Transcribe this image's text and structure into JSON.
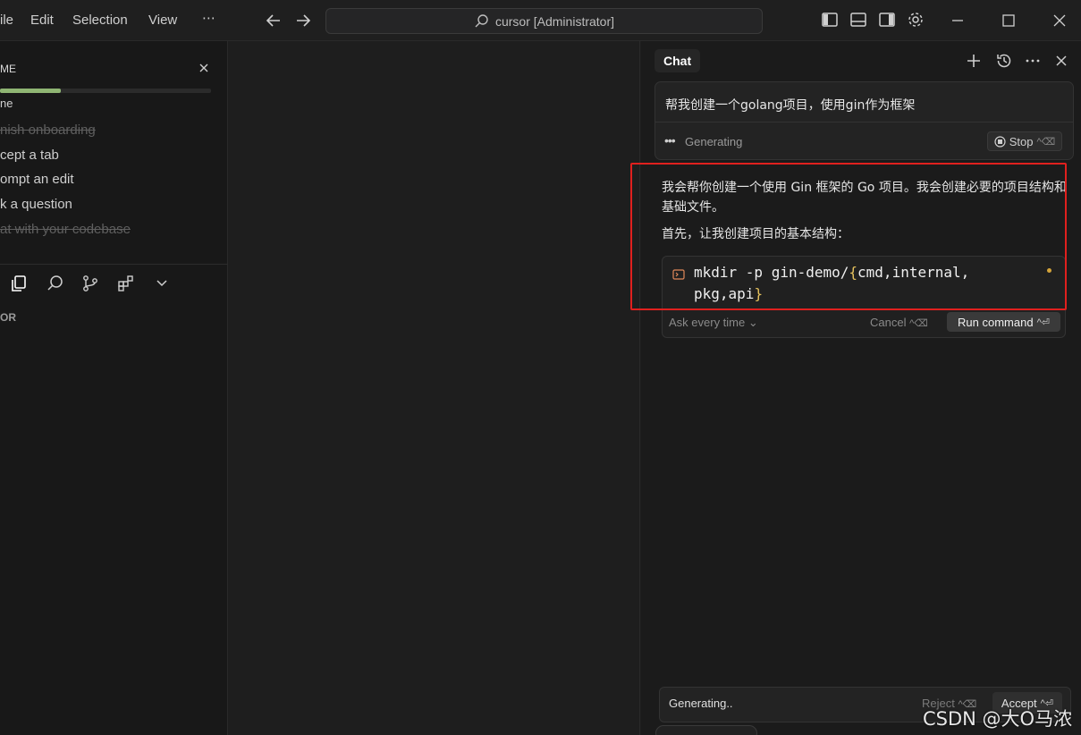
{
  "titlebar": {
    "menus": [
      "ile",
      "Edit",
      "Selection",
      "View",
      "⋯"
    ],
    "search_text": "cursor [Administrator]"
  },
  "sidebar": {
    "onboarding_title": "ME",
    "progress_fraction": 0.29,
    "onboarding_sub": "ne",
    "items": [
      {
        "label": "nish onboarding",
        "done": true
      },
      {
        "label": "cept a tab",
        "done": false
      },
      {
        "label": "ompt an edit",
        "done": false
      },
      {
        "label": "k a question",
        "done": false
      },
      {
        "label": "at with your codebase",
        "done": true
      }
    ],
    "explorer_label": "OR"
  },
  "chat": {
    "tab_label": "Chat",
    "user_message": "帮我创建一个golang项目，使用gin作为框架",
    "generating_label": "Generating",
    "stop_label": "Stop",
    "stop_shortcut": "^⌫",
    "response_para1": "我会帮你创建一个使用 Gin 框架的 Go 项目。我会创建必要的项目结构和基础文件。",
    "response_para2": "首先，让我创建项目的基本结构：",
    "command": {
      "prefix": "mkdir -p gin-demo/",
      "brace_open": "{",
      "inner": "cmd,internal, pkg,api",
      "brace_close": "}",
      "ask_label": "Ask every time",
      "cancel_label": "Cancel",
      "cancel_shortcut": "^⌫",
      "run_label": "Run command",
      "run_shortcut": "^⏎"
    },
    "bottom": {
      "generating_text": "Generating..",
      "reject_label": "Reject",
      "reject_shortcut": "^⌫",
      "accept_label": "Accept",
      "accept_shortcut": "^⏎"
    }
  },
  "watermark": "CSDN @大O马浓",
  "colors": {
    "highlight": "#e0201e",
    "progress": "#8fb573",
    "code_brace": "#e5c15d",
    "terminal_icon": "#e0885a"
  }
}
